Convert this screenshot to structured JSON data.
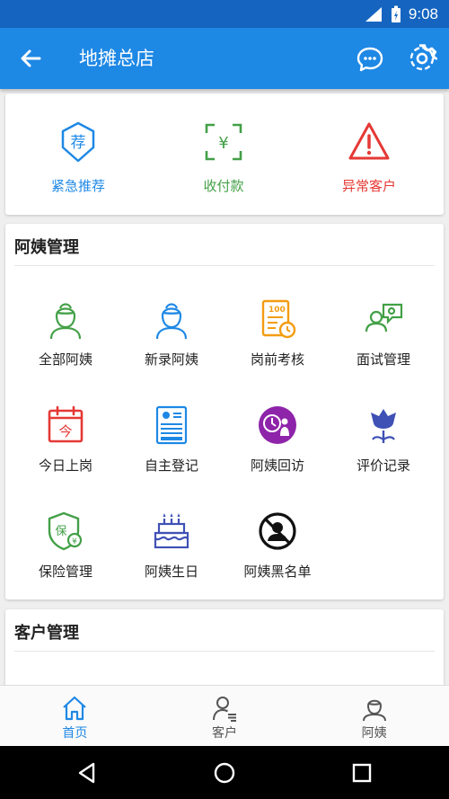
{
  "status_bar": {
    "time": "9:08"
  },
  "app_bar": {
    "title": "地摊总店"
  },
  "quick_actions": [
    {
      "label": "紧急推荐",
      "icon": "recommend-badge-icon",
      "color": "#1e88e5"
    },
    {
      "label": "收付款",
      "icon": "scan-yuan-icon",
      "color": "#43a047"
    },
    {
      "label": "异常客户",
      "icon": "warning-triangle-icon",
      "color": "#e53935"
    }
  ],
  "ayi_section": {
    "title": "阿姨管理",
    "items": [
      {
        "label": "全部阿姨",
        "icon": "caregiver-green-icon"
      },
      {
        "label": "新录阿姨",
        "icon": "caregiver-blue-icon"
      },
      {
        "label": "岗前考核",
        "icon": "exam-score-icon"
      },
      {
        "label": "面试管理",
        "icon": "interview-icon"
      },
      {
        "label": "今日上岗",
        "icon": "calendar-today-icon"
      },
      {
        "label": "自主登记",
        "icon": "registration-form-icon"
      },
      {
        "label": "阿姨回访",
        "icon": "revisit-clock-icon"
      },
      {
        "label": "评价记录",
        "icon": "review-flower-icon"
      },
      {
        "label": "保险管理",
        "icon": "insurance-shield-icon"
      },
      {
        "label": "阿姨生日",
        "icon": "birthday-cake-icon"
      },
      {
        "label": "阿姨黑名单",
        "icon": "blacklist-icon"
      }
    ]
  },
  "client_section": {
    "title": "客户管理"
  },
  "bottom_nav": [
    {
      "label": "首页",
      "active": true
    },
    {
      "label": "客户",
      "active": false
    },
    {
      "label": "阿姨",
      "active": false
    }
  ],
  "colors": {
    "primary": "#1e88e5",
    "status_bar": "#1565c0",
    "green": "#43a047",
    "red": "#e53935",
    "orange": "#f39c12",
    "purple": "#8e24aa"
  }
}
